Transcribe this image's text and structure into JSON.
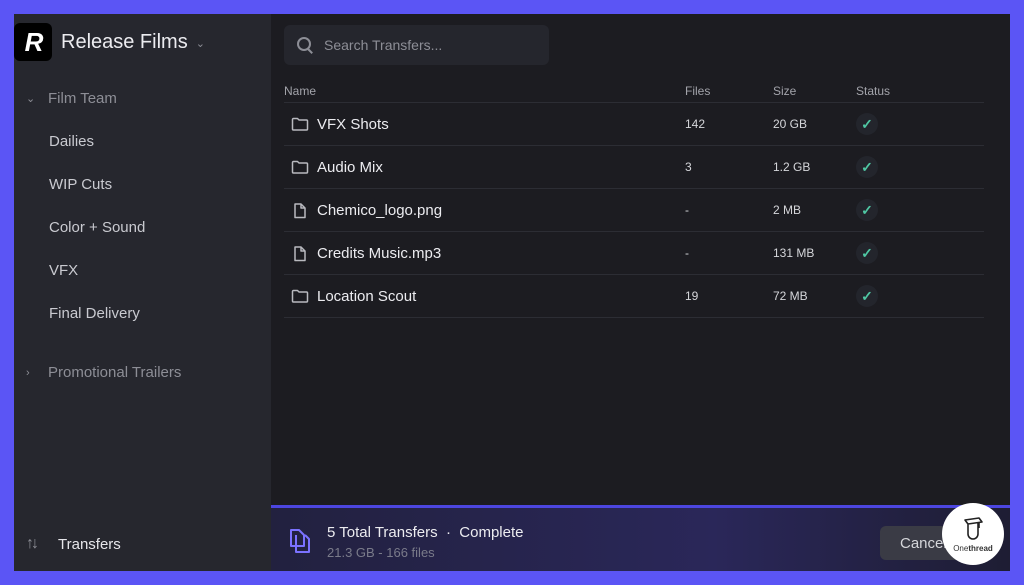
{
  "workspace": {
    "logo_letter": "R",
    "name": "Release Films"
  },
  "sidebar": {
    "groups": [
      {
        "label": "Film Team",
        "expanded": true,
        "items": [
          "Dailies",
          "WIP Cuts",
          "Color + Sound",
          "VFX",
          "Final Delivery"
        ]
      },
      {
        "label": "Promotional Trailers",
        "expanded": false,
        "items": []
      }
    ],
    "bottom_item": {
      "label": "Transfers",
      "icon": "arrows-up-down-icon"
    }
  },
  "search": {
    "placeholder": "Search Transfers..."
  },
  "table": {
    "columns": [
      "Name",
      "Files",
      "Size",
      "Status"
    ],
    "rows": [
      {
        "type": "folder",
        "name": "VFX Shots",
        "files": "142",
        "size": "20 GB",
        "status": "complete"
      },
      {
        "type": "folder",
        "name": "Audio Mix",
        "files": "3",
        "size": "1.2 GB",
        "status": "complete"
      },
      {
        "type": "file",
        "name": "Chemico_logo.png",
        "files": "-",
        "size": "2 MB",
        "status": "complete"
      },
      {
        "type": "file",
        "name": "Credits Music.mp3",
        "files": "-",
        "size": "131 MB",
        "status": "complete"
      },
      {
        "type": "folder",
        "name": "Location Scout",
        "files": "19",
        "size": "72 MB",
        "status": "complete"
      }
    ]
  },
  "footer": {
    "title": "5 Total Transfers  ·  Complete",
    "subtitle": "21.3 GB - 166 files",
    "cancel_label": "Cancel"
  },
  "watermark": {
    "text_light": "One",
    "text_bold": "thread"
  },
  "colors": {
    "frame": "#5b55f5",
    "accent": "#4c46e0",
    "success": "#4fc7a3"
  }
}
